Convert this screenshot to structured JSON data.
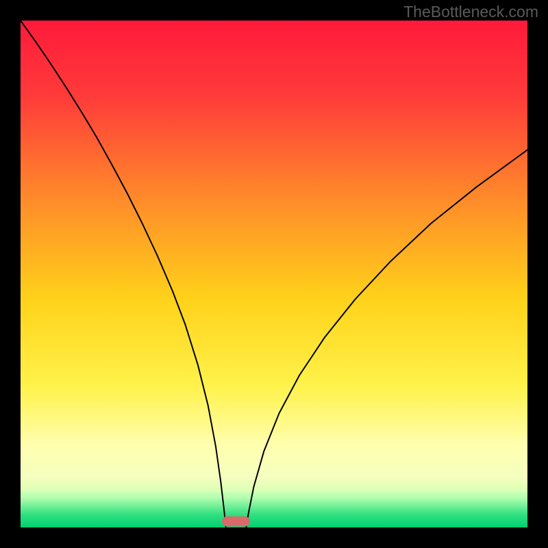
{
  "watermark": "TheBottleneck.com",
  "chart_data": {
    "type": "line",
    "title": "",
    "xlabel": "",
    "ylabel": "",
    "xlim": [
      0,
      1
    ],
    "ylim": [
      0,
      1
    ],
    "background_gradient": {
      "stops": [
        {
          "offset": 0.0,
          "color": "#ff1a3a"
        },
        {
          "offset": 0.15,
          "color": "#ff3b3a"
        },
        {
          "offset": 0.35,
          "color": "#ff8a2a"
        },
        {
          "offset": 0.55,
          "color": "#ffd21a"
        },
        {
          "offset": 0.72,
          "color": "#fff24a"
        },
        {
          "offset": 0.84,
          "color": "#ffffb0"
        },
        {
          "offset": 0.9,
          "color": "#f0ffc8"
        },
        {
          "offset": 0.94,
          "color": "#b8ffb0"
        },
        {
          "offset": 0.975,
          "color": "#30e080"
        },
        {
          "offset": 1.0,
          "color": "#00d070"
        }
      ]
    },
    "pale_band": {
      "y0": 0.82,
      "y1": 0.93,
      "color": "#ffffb0",
      "opacity": 0.35
    },
    "series": [
      {
        "name": "curve",
        "color": "#000000",
        "width": 2.0,
        "min_x": 0.405,
        "points": [
          {
            "x": 0.0,
            "y": 1.0
          },
          {
            "x": 0.03,
            "y": 0.958
          },
          {
            "x": 0.06,
            "y": 0.914
          },
          {
            "x": 0.09,
            "y": 0.868
          },
          {
            "x": 0.12,
            "y": 0.82
          },
          {
            "x": 0.15,
            "y": 0.77
          },
          {
            "x": 0.18,
            "y": 0.716
          },
          {
            "x": 0.21,
            "y": 0.66
          },
          {
            "x": 0.24,
            "y": 0.6
          },
          {
            "x": 0.27,
            "y": 0.536
          },
          {
            "x": 0.3,
            "y": 0.466
          },
          {
            "x": 0.325,
            "y": 0.4
          },
          {
            "x": 0.35,
            "y": 0.32
          },
          {
            "x": 0.37,
            "y": 0.24
          },
          {
            "x": 0.385,
            "y": 0.16
          },
          {
            "x": 0.395,
            "y": 0.09
          },
          {
            "x": 0.402,
            "y": 0.03
          },
          {
            "x": 0.405,
            "y": 0.0
          },
          {
            "x": 0.445,
            "y": 0.0
          },
          {
            "x": 0.45,
            "y": 0.03
          },
          {
            "x": 0.46,
            "y": 0.08
          },
          {
            "x": 0.48,
            "y": 0.15
          },
          {
            "x": 0.51,
            "y": 0.225
          },
          {
            "x": 0.55,
            "y": 0.3
          },
          {
            "x": 0.6,
            "y": 0.375
          },
          {
            "x": 0.66,
            "y": 0.45
          },
          {
            "x": 0.73,
            "y": 0.525
          },
          {
            "x": 0.81,
            "y": 0.6
          },
          {
            "x": 0.9,
            "y": 0.672
          },
          {
            "x": 1.0,
            "y": 0.745
          }
        ]
      }
    ],
    "marker": {
      "shape": "rounded-rect",
      "cx": 0.425,
      "cy": 0.012,
      "w": 0.055,
      "h": 0.02,
      "rx": 0.01,
      "fill": "#d96a6a"
    }
  }
}
